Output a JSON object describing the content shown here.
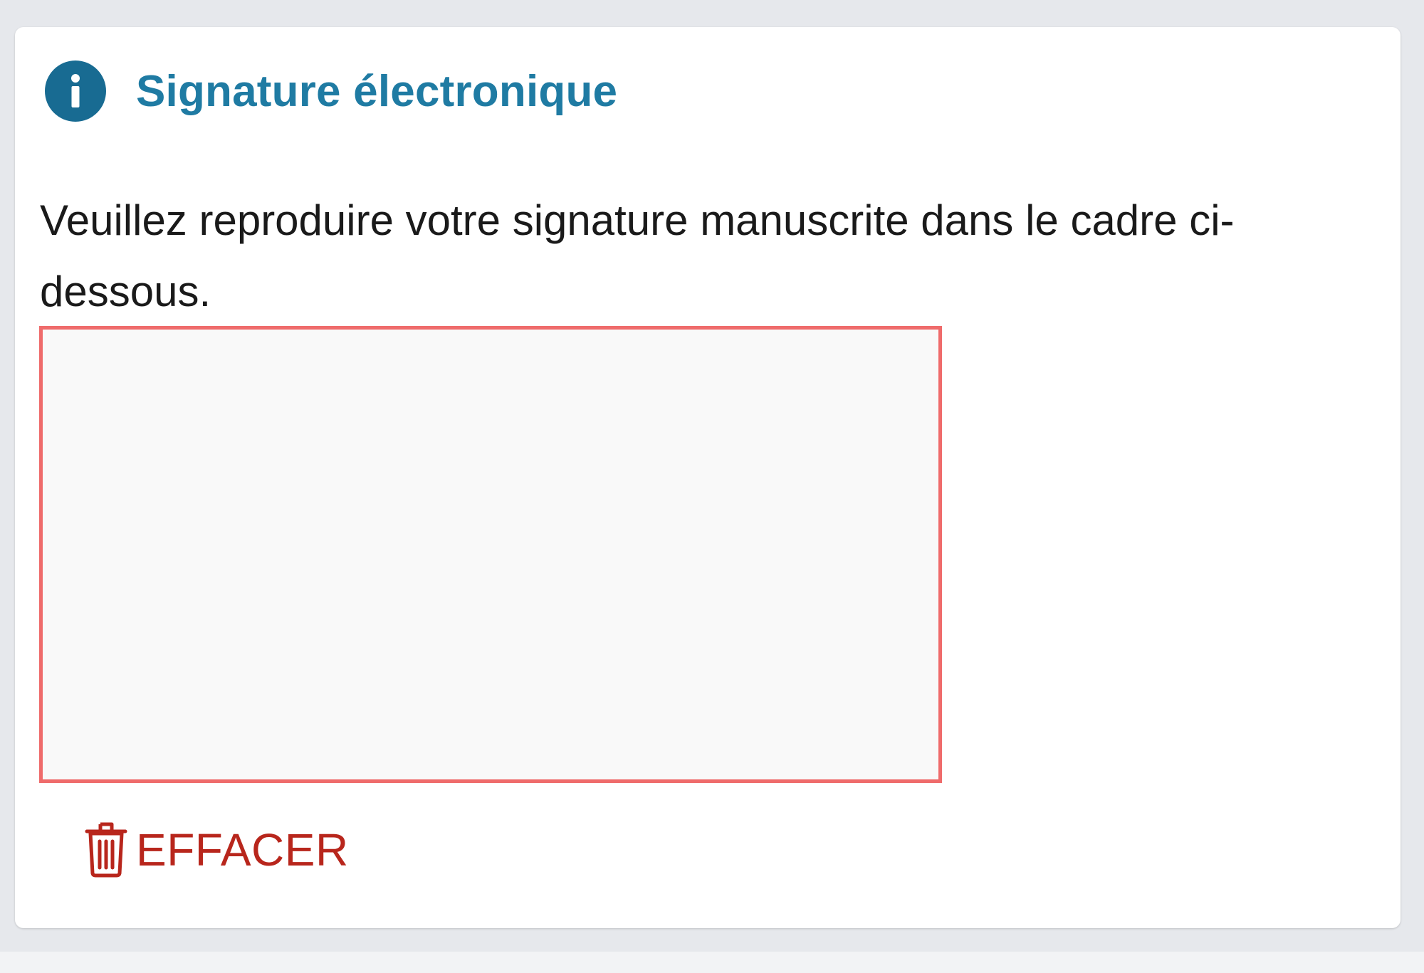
{
  "card": {
    "title": "Signature électronique",
    "info_icon": "info-icon",
    "accent_color": "#1f7ba3"
  },
  "instructions": {
    "text": "Veuillez reproduire votre signature manuscrite dans le cadre ci-dessous."
  },
  "signature_pad": {
    "border_color": "#ef6b6b",
    "background_color": "#f9f9f9"
  },
  "clear_button": {
    "label": "EFFACER",
    "icon": "trash-icon",
    "color": "#b8261c"
  }
}
